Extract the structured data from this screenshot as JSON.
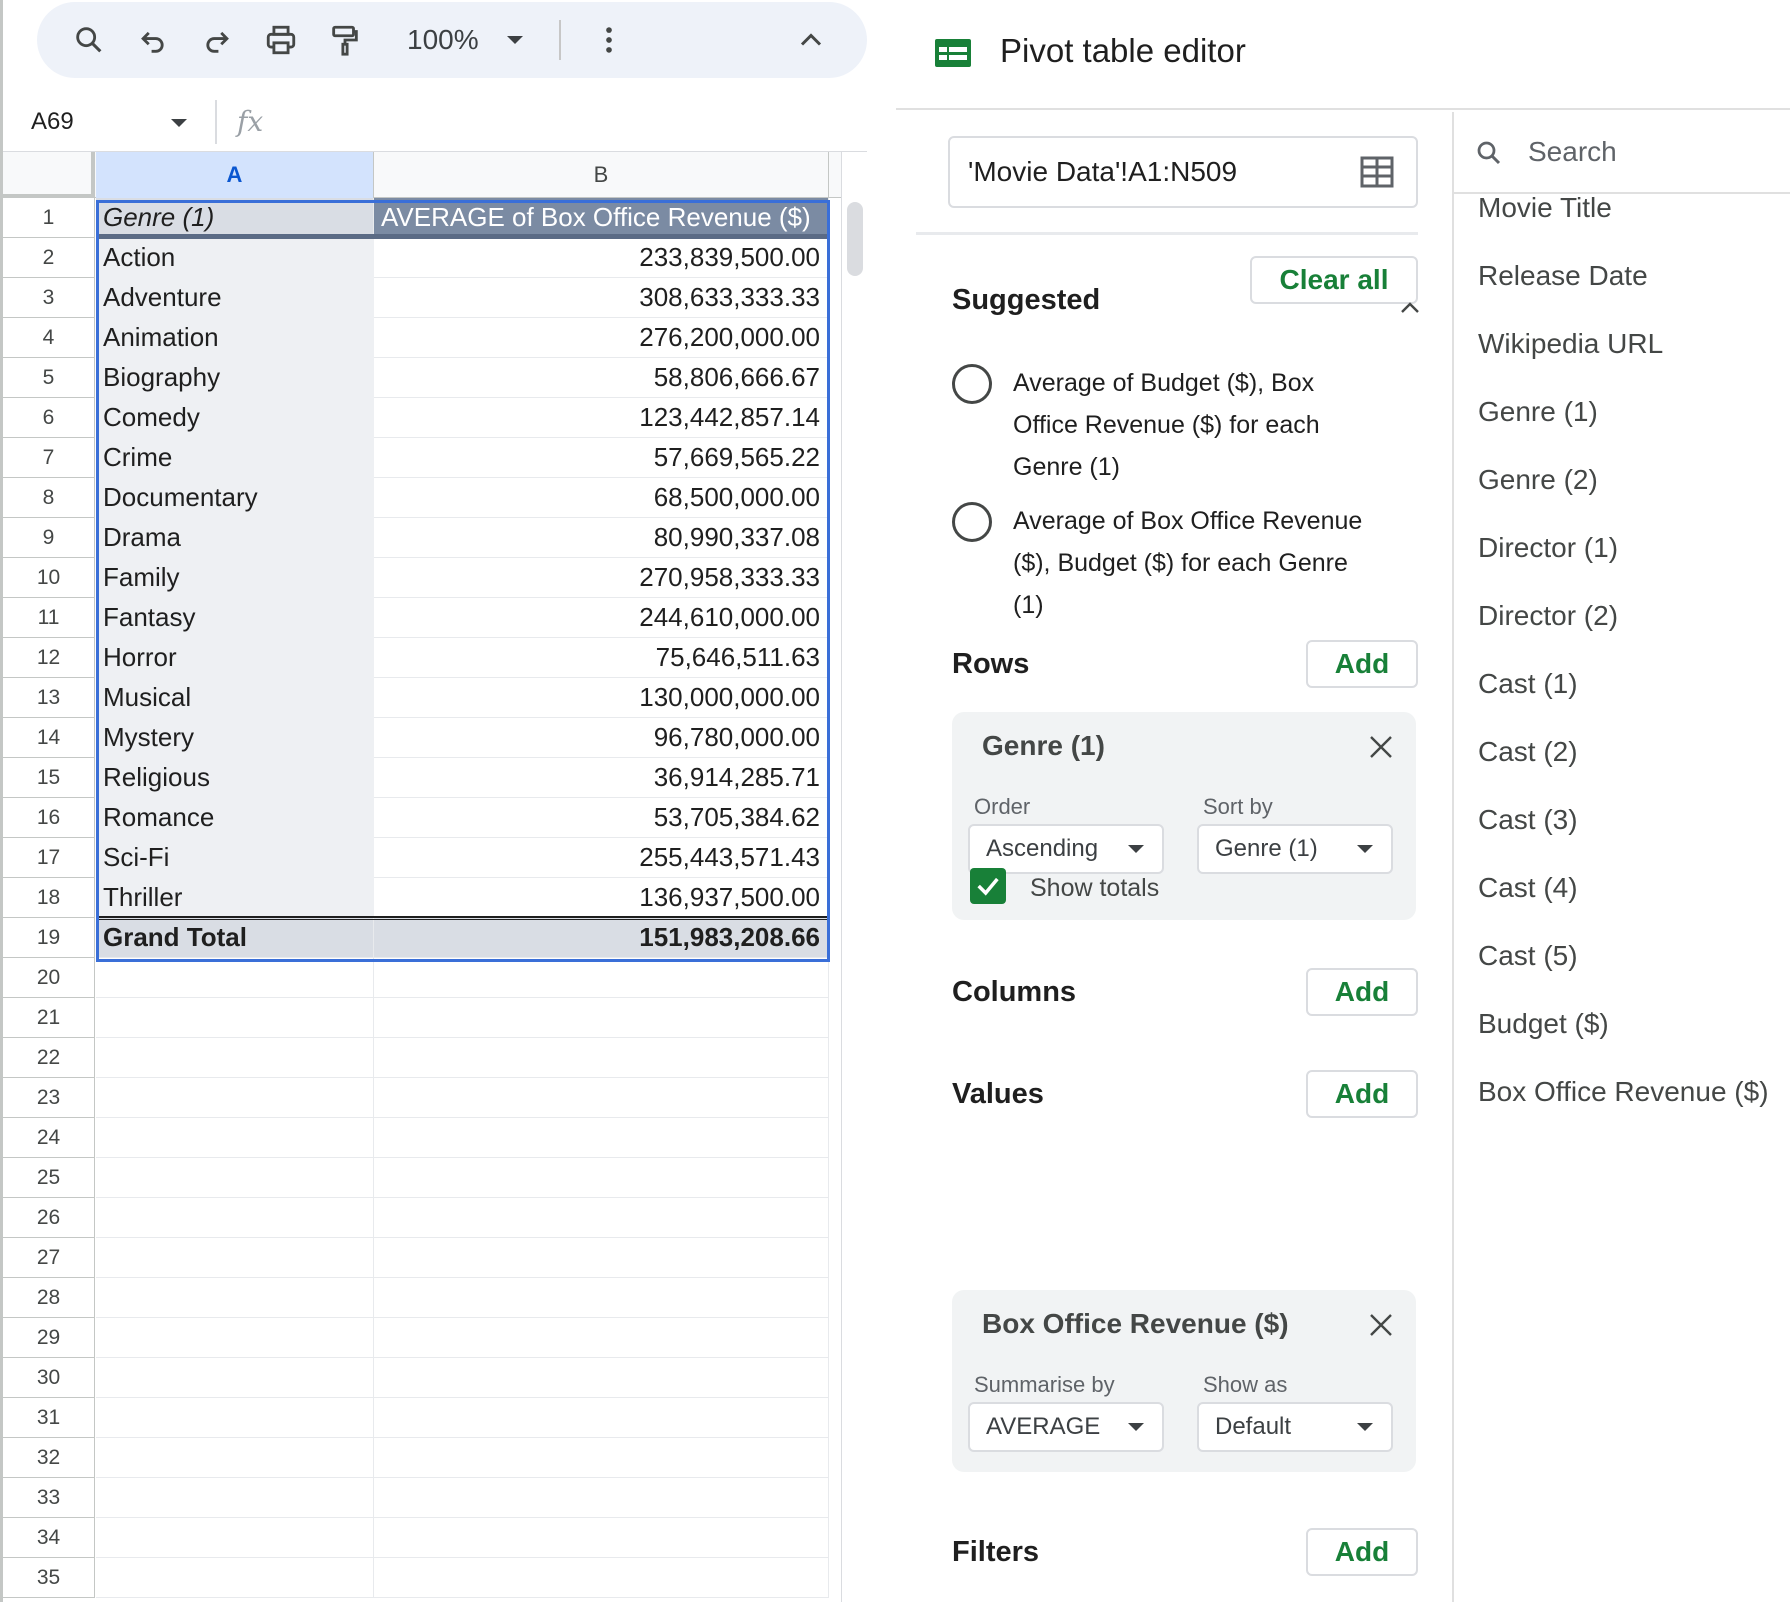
{
  "toolbar": {
    "zoom": "100%"
  },
  "formula_bar": {
    "cell_ref": "A69",
    "fx_label": "fx",
    "formula": ""
  },
  "grid": {
    "col_headers": [
      "A",
      "B"
    ],
    "header_row": {
      "a": "Genre (1)",
      "b": "AVERAGE of Box Office Revenue ($)"
    },
    "rows": [
      {
        "genre": "Action",
        "value": "233,839,500.00"
      },
      {
        "genre": "Adventure",
        "value": "308,633,333.33"
      },
      {
        "genre": "Animation",
        "value": "276,200,000.00"
      },
      {
        "genre": "Biography",
        "value": "58,806,666.67"
      },
      {
        "genre": "Comedy",
        "value": "123,442,857.14"
      },
      {
        "genre": "Crime",
        "value": "57,669,565.22"
      },
      {
        "genre": "Documentary",
        "value": "68,500,000.00"
      },
      {
        "genre": "Drama",
        "value": "80,990,337.08"
      },
      {
        "genre": "Family",
        "value": "270,958,333.33"
      },
      {
        "genre": "Fantasy",
        "value": "244,610,000.00"
      },
      {
        "genre": "Horror",
        "value": "75,646,511.63"
      },
      {
        "genre": "Musical",
        "value": "130,000,000.00"
      },
      {
        "genre": "Mystery",
        "value": "96,780,000.00"
      },
      {
        "genre": "Religious",
        "value": "36,914,285.71"
      },
      {
        "genre": "Romance",
        "value": "53,705,384.62"
      },
      {
        "genre": "Sci-Fi",
        "value": "255,443,571.43"
      },
      {
        "genre": "Thriller",
        "value": "136,937,500.00"
      }
    ],
    "total_row": {
      "label": "Grand Total",
      "value": "151,983,208.66"
    },
    "row_numbers": [
      "1",
      "2",
      "3",
      "4",
      "5",
      "6",
      "7",
      "8",
      "9",
      "10",
      "11",
      "12",
      "13",
      "14",
      "15",
      "16",
      "17",
      "18",
      "19",
      "20",
      "21",
      "22",
      "23",
      "24",
      "25",
      "26",
      "27",
      "28",
      "29",
      "30",
      "31",
      "32",
      "33",
      "34",
      "35"
    ]
  },
  "editor": {
    "title": "Pivot table editor",
    "range": "'Movie Data'!A1:N509",
    "clear_all": "Clear all",
    "suggested": {
      "title": "Suggested",
      "items": [
        [
          "Average of Budget ($), Box",
          "Office Revenue ($) for each",
          "Genre (1)"
        ],
        [
          "Average of Box Office Revenue",
          "($), Budget ($) for each Genre",
          "(1)"
        ]
      ]
    },
    "rows_section": {
      "title": "Rows",
      "add": "Add",
      "card": {
        "title": "Genre (1)",
        "order_label": "Order",
        "order_value": "Ascending",
        "sort_label": "Sort by",
        "sort_value": "Genre (1)",
        "show_totals": "Show totals",
        "show_totals_checked": true
      }
    },
    "columns_section": {
      "title": "Columns",
      "add": "Add"
    },
    "values_section": {
      "title": "Values",
      "add": "Add",
      "card": {
        "title": "Box Office Revenue ($)",
        "summarise_label": "Summarise by",
        "summarise_value": "AVERAGE",
        "show_as_label": "Show as",
        "show_as_value": "Default"
      }
    },
    "filters_section": {
      "title": "Filters",
      "add": "Add"
    },
    "fields": {
      "search_placeholder": "Search",
      "items": [
        "Movie Title",
        "Release Date",
        "Wikipedia URL",
        "Genre (1)",
        "Genre (2)",
        "Director (1)",
        "Director (2)",
        "Cast (1)",
        "Cast (2)",
        "Cast (3)",
        "Cast (4)",
        "Cast (5)",
        "Budget ($)",
        "Box Office Revenue ($)"
      ]
    }
  },
  "colors": {
    "accent_green": "#188038",
    "pivot_header_bg": "#7b8ba3",
    "selection_blue": "#3a6fd8"
  }
}
